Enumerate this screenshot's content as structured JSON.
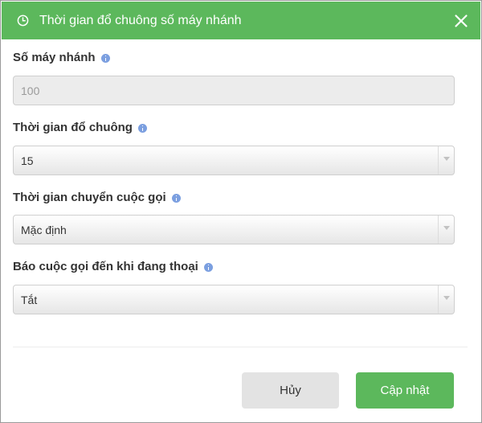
{
  "dialog": {
    "title": "Thời gian đổ chuông số máy nhánh",
    "clock_icon": "clock-icon",
    "close_icon": "close-icon"
  },
  "fields": {
    "extension": {
      "label": "Số máy nhánh",
      "value": "100"
    },
    "ring_time": {
      "label": "Thời gian đổ chuông",
      "value": "15"
    },
    "forward_time": {
      "label": "Thời gian chuyển cuộc gọi",
      "value": "Mặc định"
    },
    "call_waiting": {
      "label": "Báo cuộc gọi đến khi đang thoại",
      "value": "Tắt"
    }
  },
  "footer": {
    "cancel_label": "Hủy",
    "submit_label": "Cập nhật"
  },
  "colors": {
    "header": "#5cb85c",
    "submit": "#5cb85c",
    "info_icon": "#7b9fe0"
  }
}
